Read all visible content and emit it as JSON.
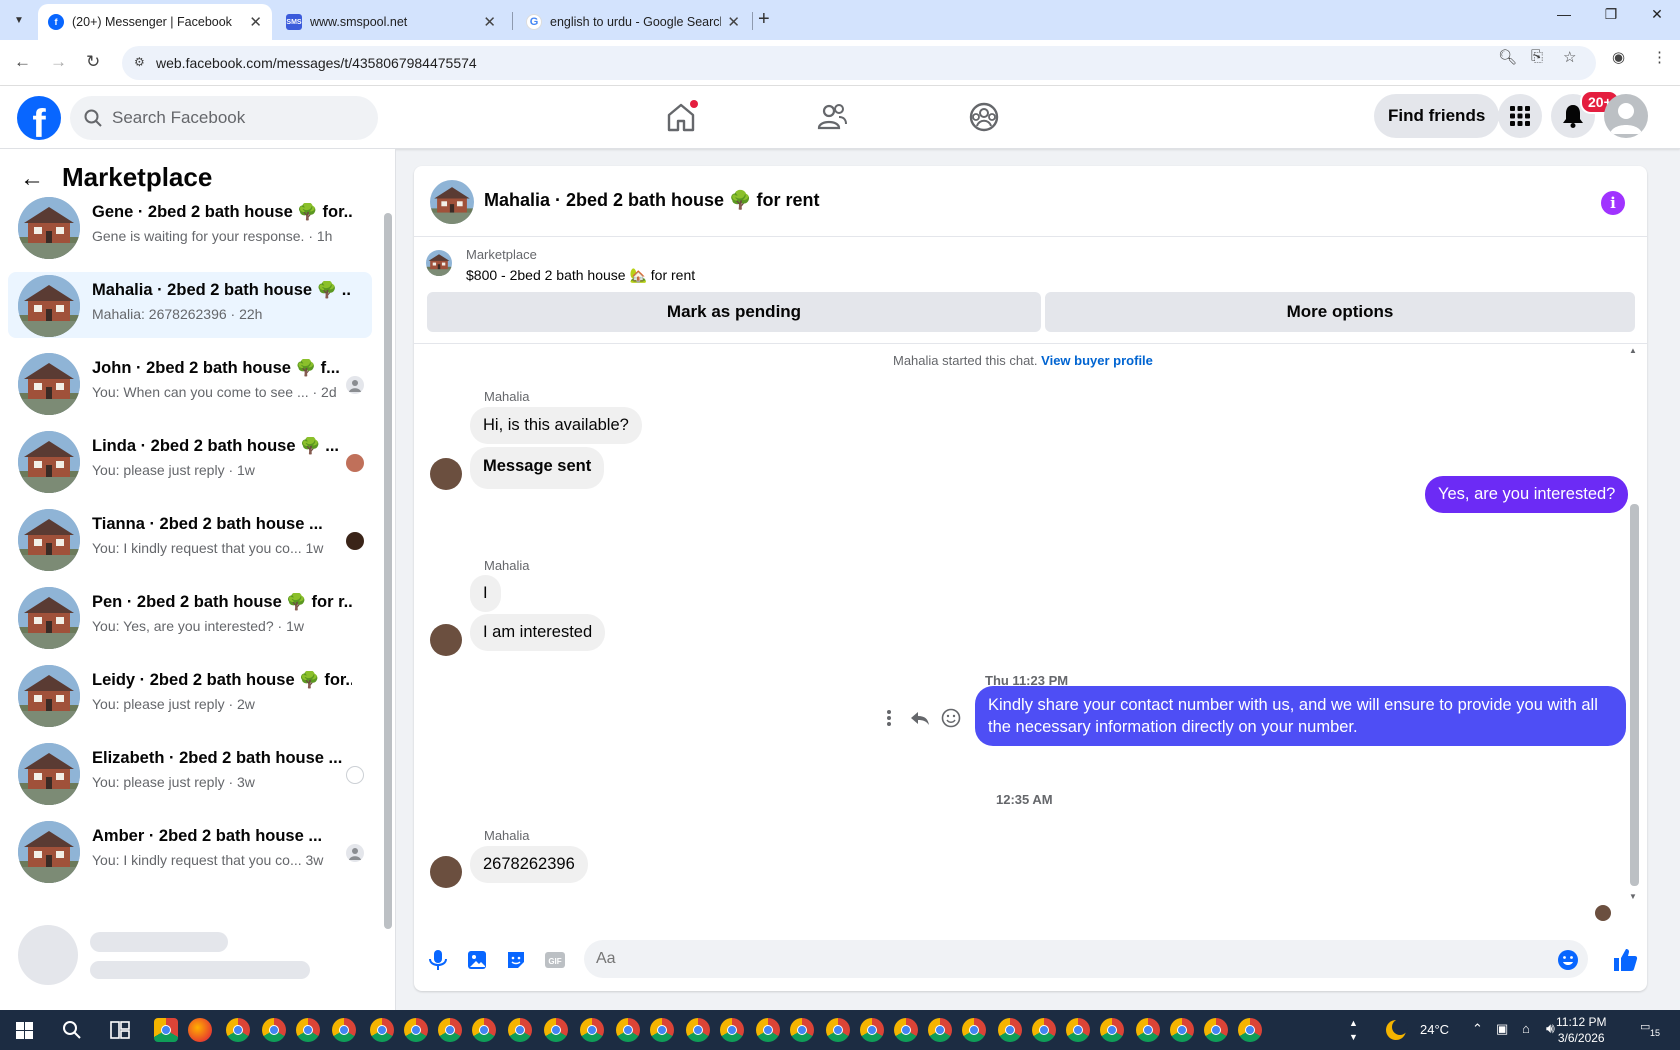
{
  "browser": {
    "tabs": [
      {
        "title": "(20+) Messenger | Facebook",
        "icon": "facebook-icon",
        "active": true
      },
      {
        "title": "www.smspool.net",
        "icon": "sms-icon",
        "active": false
      },
      {
        "title": "english to urdu - Google Search",
        "icon": "google-icon",
        "active": false
      }
    ],
    "url": "web.facebook.com/messages/t/4358067984475574"
  },
  "header": {
    "search_placeholder": "Search Facebook",
    "find_friends": "Find friends",
    "notification_count": "20+",
    "logo_letter": "f"
  },
  "sidebar": {
    "title": "Marketplace",
    "conversations": [
      {
        "name": "Gene · 2bed 2 bath house 🌳 for...",
        "preview": "Gene is waiting for your response. · 1h",
        "active": false
      },
      {
        "name": "Mahalia · 2bed 2 bath house 🌳 ...",
        "preview": "Mahalia: 2678262396 · 22h",
        "active": true
      },
      {
        "name": "John · 2bed 2 bath house 🌳 f...",
        "preview": "You: When can you come to see ... · 2d",
        "active": false
      },
      {
        "name": "Linda · 2bed 2 bath house 🌳 ...",
        "preview": "You: please just reply · 1w",
        "active": false
      },
      {
        "name": "Tianna · 2bed 2 bath house ...",
        "preview": "You: I kindly request that you co...   1w",
        "active": false
      },
      {
        "name": "Pen · 2bed 2 bath house 🌳 for r...",
        "preview": "You: Yes, are you interested? · 1w",
        "active": false
      },
      {
        "name": "Leidy · 2bed 2 bath house 🌳 for...",
        "preview": "You: please just reply · 2w",
        "active": false
      },
      {
        "name": "Elizabeth · 2bed 2 bath house ...",
        "preview": "You: please just reply · 3w",
        "active": false
      },
      {
        "name": "Amber · 2bed 2 bath house ...",
        "preview": "You: I kindly request that you co...   3w",
        "active": false
      }
    ]
  },
  "chat": {
    "title": "Mahalia · 2bed 2 bath house 🌳 for rent",
    "marketplace_label": "Marketplace",
    "listing": "$800 - 2bed 2 bath house 🏡 for rent",
    "mark_pending": "Mark as pending",
    "more_options": "More options",
    "started_note": "Mahalia started this chat.",
    "buyer_profile_link": "View buyer profile",
    "sender_name": "Mahalia",
    "messages": {
      "m1": "Hi, is this available?",
      "m2": "Message sent",
      "m3": "Yes, are you interested?",
      "m4": "I",
      "m5": "I am interested",
      "m6": "Kindly share your contact number with us, and we will ensure to provide you with all the necessary information directly on your number.",
      "m7": "2678262396"
    },
    "timestamp1": "Thu 11:23 PM",
    "timestamp2": "12:35 AM",
    "composer_placeholder": "Aa"
  },
  "taskbar": {
    "temperature": "24°C",
    "time": "11:12 PM",
    "date": "3/6/2026",
    "notifications": "15"
  },
  "colors": {
    "fb_blue": "#0866ff",
    "outgoing_purple": "#6c2bf5",
    "outgoing_blue": "#4e4ef5",
    "info_purple": "#a033ff",
    "badge_red": "#e41e3f"
  }
}
